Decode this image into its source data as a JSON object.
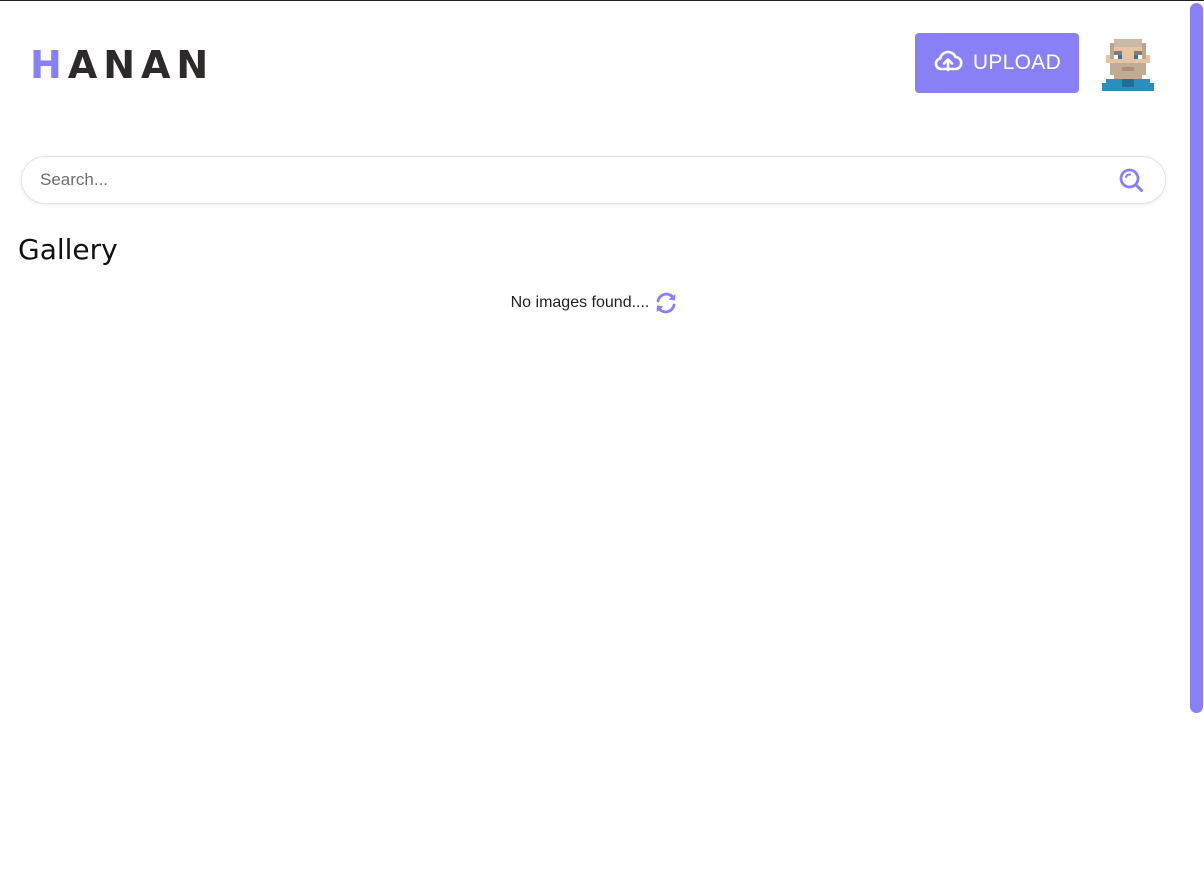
{
  "header": {
    "logo_first": "H",
    "logo_rest": "ANAN",
    "upload_label": "UPLOAD"
  },
  "search": {
    "placeholder": "Search...",
    "value": ""
  },
  "gallery": {
    "title": "Gallery",
    "empty_message": "No images found...."
  },
  "icons": {
    "upload": "cloud-upload-icon",
    "search": "search-icon",
    "refresh": "refresh-icon",
    "avatar": "pixel-avatar"
  },
  "colors": {
    "accent": "#8a80f6",
    "logo_text": "#2f2a2a",
    "background": "#ffffff"
  }
}
